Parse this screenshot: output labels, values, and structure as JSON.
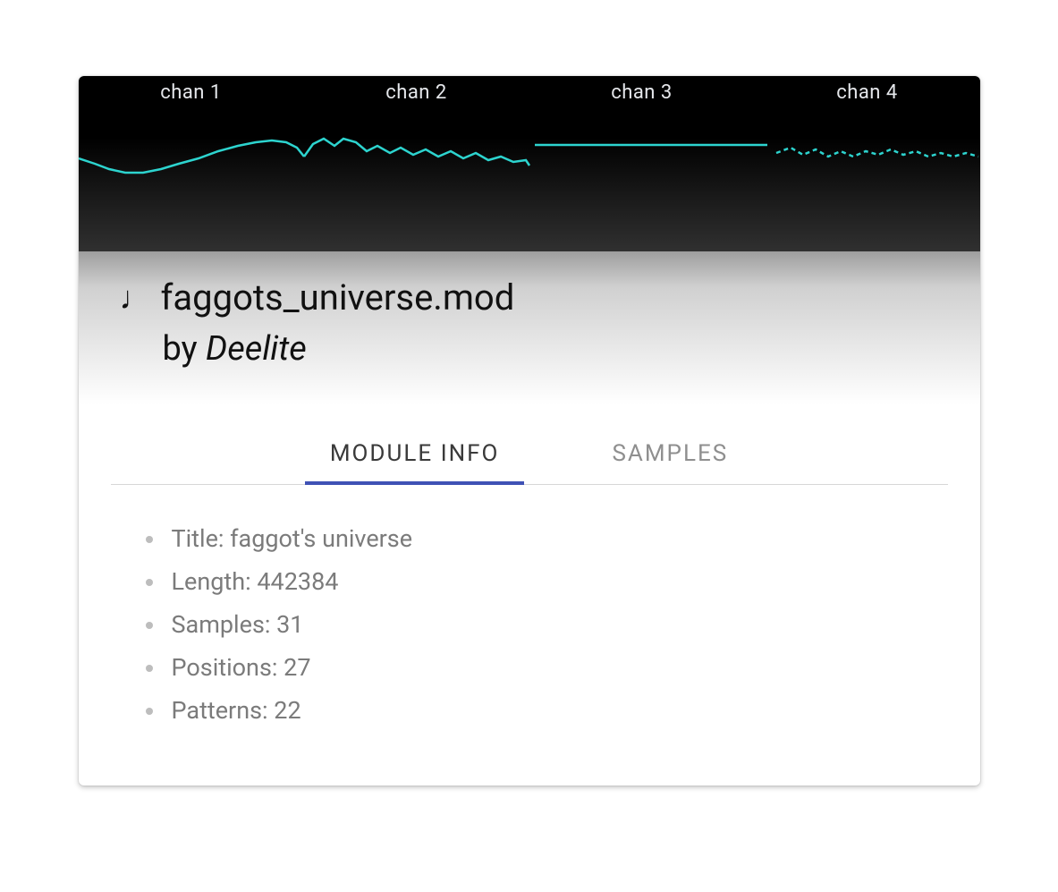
{
  "channels": [
    "chan 1",
    "chan 2",
    "chan 3",
    "chan 4"
  ],
  "colors": {
    "waveform": "#2dd4cf",
    "tab_active": "#3f51b5"
  },
  "title": {
    "filename": "faggots_universe.mod",
    "by_prefix": "by ",
    "author": "Deelite"
  },
  "tabs": {
    "module_info": "MODULE INFO",
    "samples": "SAMPLES",
    "active": "module_info"
  },
  "module_info": {
    "title_label": "Title: ",
    "title_value": "faggot's universe",
    "length_label": "Length: ",
    "length_value": "442384",
    "samples_label": "Samples: ",
    "samples_value": "31",
    "positions_label": "Positions: ",
    "positions_value": "27",
    "patterns_label": "Patterns: ",
    "patterns_value": "22"
  }
}
